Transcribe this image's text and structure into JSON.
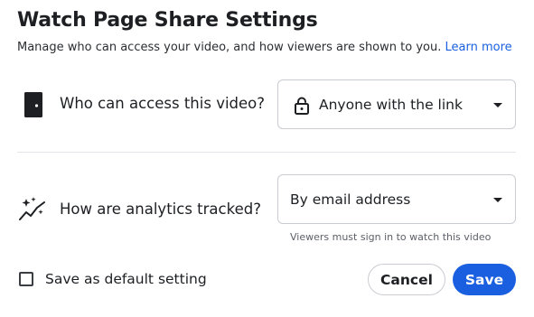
{
  "title": "Watch Page Share Settings",
  "subtitle": {
    "text": "Manage who can access your video, and how viewers are shown to you.",
    "link": "Learn more"
  },
  "access": {
    "label": "Who can access this video?",
    "value": "Anyone with the link",
    "icon": "door-icon",
    "value_icon": "lock-icon"
  },
  "analytics": {
    "label": "How are analytics tracked?",
    "value": "By email address",
    "icon": "sparkle-chart-icon",
    "hint": "Viewers must sign in to watch this video"
  },
  "default_setting": {
    "label": "Save as default setting",
    "checked": false
  },
  "buttons": {
    "cancel": "Cancel",
    "save": "Save"
  },
  "colors": {
    "accent": "#1a5fe0",
    "border": "#c9ccd1",
    "text": "#1d1f23"
  }
}
